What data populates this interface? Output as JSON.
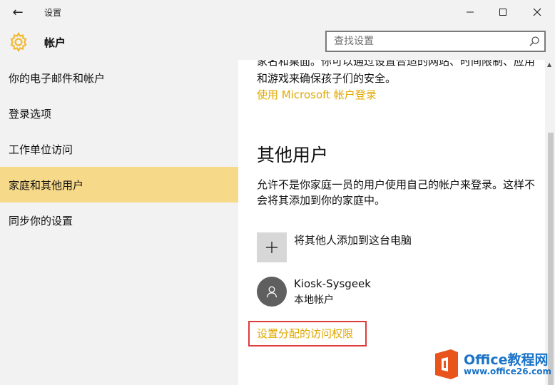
{
  "window": {
    "title": "设置",
    "back_glyph": "←",
    "minimize_glyph": "—",
    "maximize_glyph": "☐",
    "close_glyph": "✕"
  },
  "header": {
    "title": "帐户",
    "icon": "gear-icon",
    "accent_color": "#f2b92e"
  },
  "search": {
    "placeholder": "查找设置",
    "icon": "search-icon"
  },
  "sidebar": {
    "items": [
      {
        "label": "你的电子邮件和帐户",
        "active": false
      },
      {
        "label": "登录选项",
        "active": false
      },
      {
        "label": "工作单位访问",
        "active": false
      },
      {
        "label": "家庭和其他用户",
        "active": true
      },
      {
        "label": "同步你的设置",
        "active": false
      }
    ],
    "active_color": "#f7d98a"
  },
  "main": {
    "cut_text": "家名和桌面。你可以通过设置合适的网站、时间限制、应用和游戏来确保孩子们的安全。",
    "ms_link": "使用 Microsoft 帐户登录",
    "section_title": "其他用户",
    "description": "允许不是你家庭一员的用户使用自己的帐户来登录。这样不会将其添加到你的家庭中。",
    "add_label": "将其他人添加到这台电脑",
    "user": {
      "name": "Kiosk-Sysgeek",
      "type": "本地帐户"
    },
    "access_link": "设置分配的访问权限",
    "link_color": "#e0a800",
    "highlight_color": "#e03b3b"
  },
  "watermark": {
    "brand": "Office教程网",
    "url": "www.office26.com"
  }
}
